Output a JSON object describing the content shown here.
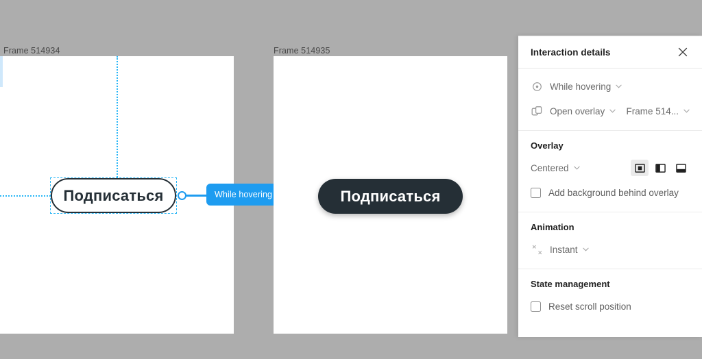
{
  "canvas": {
    "background_color": "#adadad",
    "frames": [
      {
        "label": "Frame 514934",
        "selected": true
      },
      {
        "label": "Frame 514935",
        "selected": false
      }
    ],
    "buttons": [
      {
        "text": "Подписаться",
        "style": "outline"
      },
      {
        "text": "Подписаться",
        "style": "filled"
      }
    ],
    "connection": {
      "label": "While hovering",
      "badge_icon": "open-overlay-icon",
      "accent_color": "#1e9cf0"
    }
  },
  "panel": {
    "title": "Interaction details",
    "close_icon": "close-icon",
    "trigger": {
      "icon": "hover-trigger-icon",
      "value": "While hovering"
    },
    "action": {
      "icon": "open-overlay-icon",
      "value": "Open overlay",
      "target": "Frame 514..."
    },
    "overlay": {
      "title": "Overlay",
      "position_value": "Centered",
      "position_options": [
        {
          "icon": "overlay-centered-icon",
          "name": "centered",
          "selected": true
        },
        {
          "icon": "overlay-left-icon",
          "name": "left",
          "selected": false
        },
        {
          "icon": "overlay-bottom-icon",
          "name": "bottom",
          "selected": false
        }
      ],
      "background_checkbox": {
        "label": "Add background behind overlay",
        "checked": false
      }
    },
    "animation": {
      "title": "Animation",
      "icon": "instant-animation-icon",
      "value": "Instant"
    },
    "state_management": {
      "title": "State management",
      "reset_checkbox": {
        "label": "Reset scroll position",
        "checked": false
      }
    }
  }
}
